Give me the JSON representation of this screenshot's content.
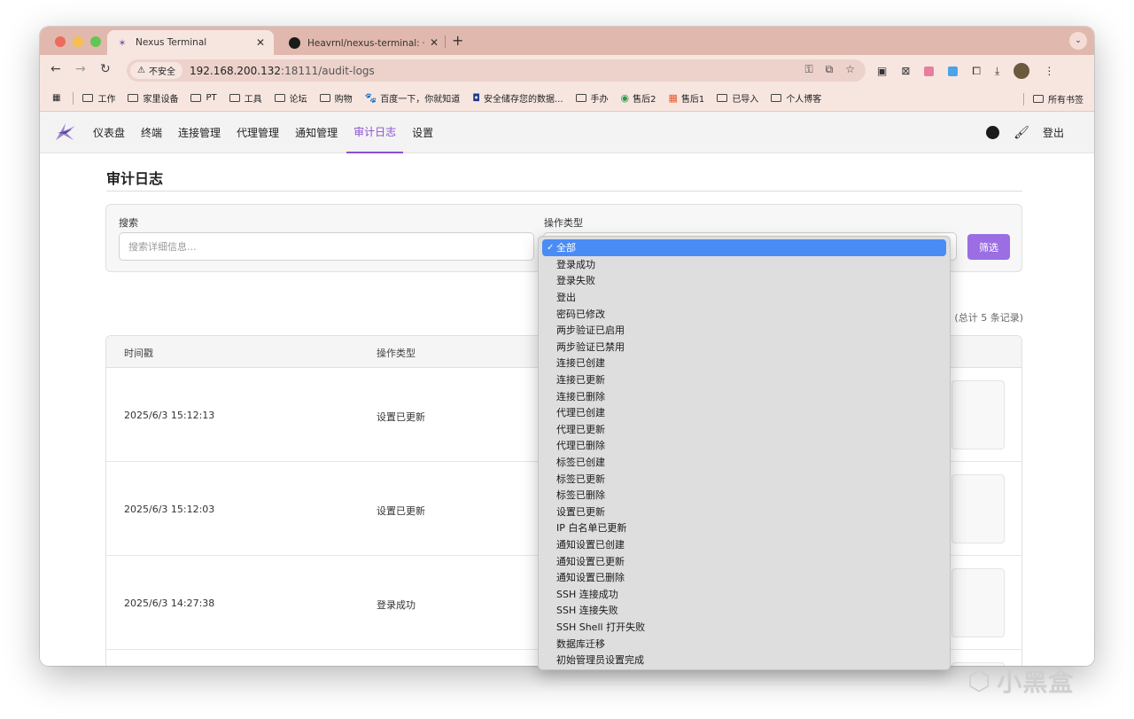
{
  "browser": {
    "tabs": [
      {
        "title": "Nexus Terminal",
        "active": true
      },
      {
        "title": "Heavrnl/nexus-terminal: 一款",
        "active": false
      }
    ],
    "security_label": "不安全",
    "url_host": "192.168.200.132",
    "url_path": ":18111/audit-logs",
    "bookmarks": [
      {
        "label": "工作",
        "icon": "folder-icon"
      },
      {
        "label": "家里设备",
        "icon": "folder-icon"
      },
      {
        "label": "PT",
        "icon": "folder-icon"
      },
      {
        "label": "工具",
        "icon": "folder-icon"
      },
      {
        "label": "论坛",
        "icon": "folder-icon"
      },
      {
        "label": "购物",
        "icon": "folder-icon"
      },
      {
        "label": "百度一下，你就知道",
        "icon": "baidu-icon"
      },
      {
        "label": "安全储存您的数据...",
        "icon": "storage-icon"
      },
      {
        "label": "手办",
        "icon": "folder-icon"
      },
      {
        "label": "售后2",
        "icon": "app-icon"
      },
      {
        "label": "售后1",
        "icon": "windows-icon"
      },
      {
        "label": "已导入",
        "icon": "folder-icon"
      },
      {
        "label": "个人博客",
        "icon": "folder-icon"
      }
    ],
    "all_bookmarks": "所有书签"
  },
  "app": {
    "nav": [
      "仪表盘",
      "终端",
      "连接管理",
      "代理管理",
      "通知管理",
      "审计日志",
      "设置"
    ],
    "active_nav_index": 5,
    "logout": "登出"
  },
  "page": {
    "title": "审计日志",
    "search_label": "搜索",
    "search_placeholder": "搜索详细信息...",
    "type_label": "操作类型",
    "filter_button": "筛选",
    "record_count": "(总计 5 条记录)",
    "table": {
      "headers": [
        "时间戳",
        "操作类型"
      ],
      "rows": [
        {
          "timestamp": "2025/6/3 15:12:13",
          "action": "设置已更新"
        },
        {
          "timestamp": "2025/6/3 15:12:03",
          "action": "设置已更新"
        },
        {
          "timestamp": "2025/6/3 14:27:38",
          "action": "登录成功"
        }
      ]
    },
    "dropdown": {
      "selected_index": 0,
      "options": [
        "全部",
        "登录成功",
        "登录失败",
        "登出",
        "密码已修改",
        "两步验证已启用",
        "两步验证已禁用",
        "连接已创建",
        "连接已更新",
        "连接已删除",
        "代理已创建",
        "代理已更新",
        "代理已删除",
        "标签已创建",
        "标签已更新",
        "标签已删除",
        "设置已更新",
        "IP 白名单已更新",
        "通知设置已创建",
        "通知设置已更新",
        "通知设置已删除",
        "SSH 连接成功",
        "SSH 连接失败",
        "SSH Shell 打开失败",
        "数据库迁移",
        "初始管理员设置完成"
      ]
    }
  },
  "watermark": "小黑盒",
  "colors": {
    "accent": "#8b4fd1",
    "filter_button": "#9b6ee3",
    "tabstrip": "#e1b8ad",
    "toolbar": "#f7e6e0",
    "dropdown_selected": "#4a8cf5"
  }
}
